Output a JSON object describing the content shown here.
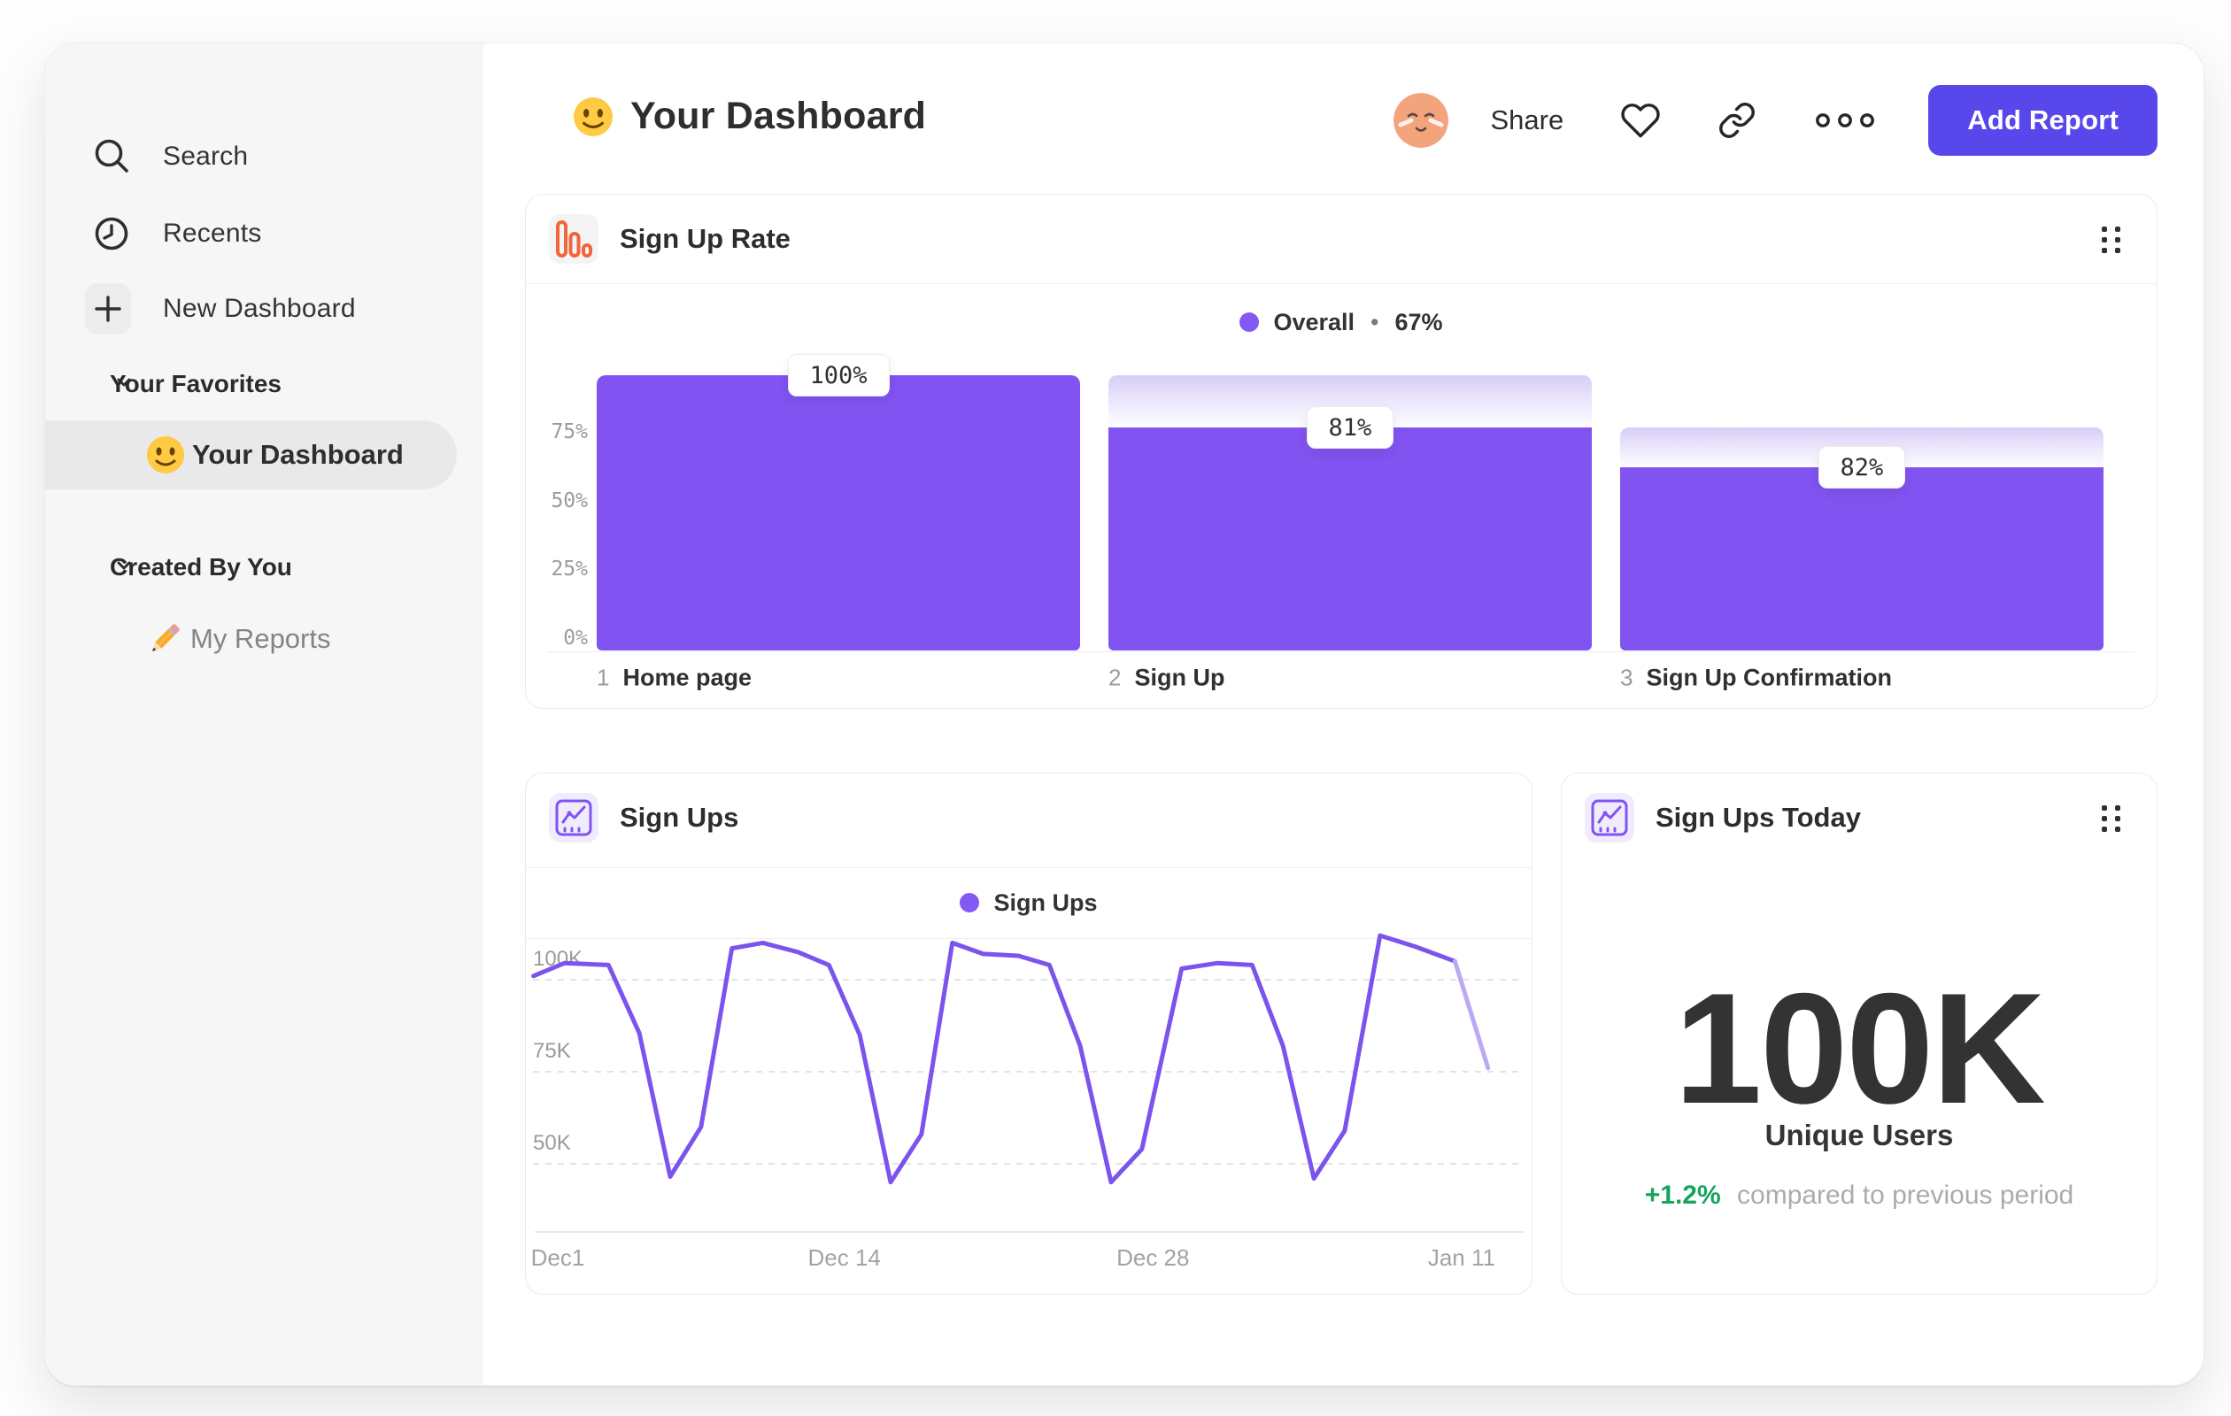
{
  "sidebar": {
    "items": [
      {
        "label": "Search",
        "icon": "search-icon"
      },
      {
        "label": "Recents",
        "icon": "clock-icon"
      },
      {
        "label": "New Dashboard",
        "icon": "plus-icon"
      }
    ],
    "sections": [
      {
        "label": "Your Favorites",
        "item": {
          "label": "Your Dashboard",
          "icon": "smiley-emoji",
          "selected": true
        }
      },
      {
        "label": "Created By You",
        "item": {
          "label": "My Reports",
          "icon": "pencil-emoji",
          "selected": false
        }
      }
    ]
  },
  "header": {
    "title": "Your Dashboard",
    "share_label": "Share",
    "add_report_label": "Add Report"
  },
  "funnel_card": {
    "title": "Sign Up Rate",
    "legend_label": "Overall",
    "legend_separator": "•",
    "legend_value": "67%"
  },
  "line_card": {
    "title": "Sign Ups",
    "legend_label": "Sign Ups"
  },
  "metric_card": {
    "title": "Sign Ups Today",
    "value": "100K",
    "subtitle": "Unique Users",
    "delta": "+1.2%",
    "delta_caption": "compared to previous period",
    "delta_color": "#17A45C"
  },
  "colors": {
    "accent_purple": "#8153F1",
    "line_purple": "#7C53EC",
    "faded_purple": "#BCA8F5",
    "button_purple": "#5848EB",
    "icon_orange": "#F2653C",
    "positive_green": "#17A45C"
  },
  "chart_data": [
    {
      "type": "bar",
      "title": "Sign Up Rate",
      "legend": "Overall",
      "overall_pct": "67%",
      "categories": [
        "Home page",
        "Sign Up",
        "Sign Up Confirmation"
      ],
      "step_numbers": [
        "1",
        "2",
        "3"
      ],
      "step_conversion_pct": [
        100,
        81,
        82
      ],
      "cumulative_pct": [
        100,
        81,
        66.4
      ],
      "value_labels": [
        "100%",
        "81%",
        "82%"
      ],
      "y_ticks": [
        {
          "label": "75%",
          "value": 75
        },
        {
          "label": "50%",
          "value": 50
        },
        {
          "label": "25%",
          "value": 25
        },
        {
          "label": "0%",
          "value": 0
        }
      ],
      "ylim": [
        0,
        100
      ],
      "grid": false,
      "legend_position": "top-center"
    },
    {
      "type": "line",
      "title": "Sign Ups",
      "legend": "Sign Ups",
      "xlabel": "",
      "ylabel": "",
      "ylim_shown": [
        50,
        100
      ],
      "y_ticks": [
        {
          "label": "100K",
          "value": 100
        },
        {
          "label": "75K",
          "value": 75
        },
        {
          "label": "50K",
          "value": 50
        }
      ],
      "x_ticks": [
        {
          "label": "Dec1",
          "day": 0
        },
        {
          "label": "Dec 14",
          "day": 13
        },
        {
          "label": "Dec 28",
          "day": 27
        },
        {
          "label": "Jan 11",
          "day": 41
        }
      ],
      "unit": "K signups per day",
      "points": [
        [
          -1.1,
          101
        ],
        [
          0.3,
          104.5
        ],
        [
          2.3,
          104
        ],
        [
          3.7,
          85.5
        ],
        [
          5.1,
          46.5
        ],
        [
          6.5,
          60
        ],
        [
          7.9,
          108.5
        ],
        [
          9.3,
          110
        ],
        [
          10.9,
          107.5
        ],
        [
          12.3,
          104
        ],
        [
          13.7,
          85
        ],
        [
          15.1,
          45
        ],
        [
          16.5,
          58
        ],
        [
          17.9,
          110
        ],
        [
          19.3,
          107
        ],
        [
          20.9,
          106.5
        ],
        [
          22.3,
          104
        ],
        [
          23.7,
          82
        ],
        [
          25.1,
          45
        ],
        [
          26.5,
          54
        ],
        [
          28.3,
          103
        ],
        [
          29.9,
          104.5
        ],
        [
          31.5,
          104
        ],
        [
          32.9,
          82
        ],
        [
          34.3,
          46
        ],
        [
          35.7,
          59
        ],
        [
          37.3,
          112
        ],
        [
          38.9,
          109
        ],
        [
          40.7,
          105
        ],
        [
          42.2,
          76
        ]
      ],
      "faded_from_index": 28,
      "grid": "dashed-horizontal",
      "legend_position": "top-center"
    }
  ]
}
